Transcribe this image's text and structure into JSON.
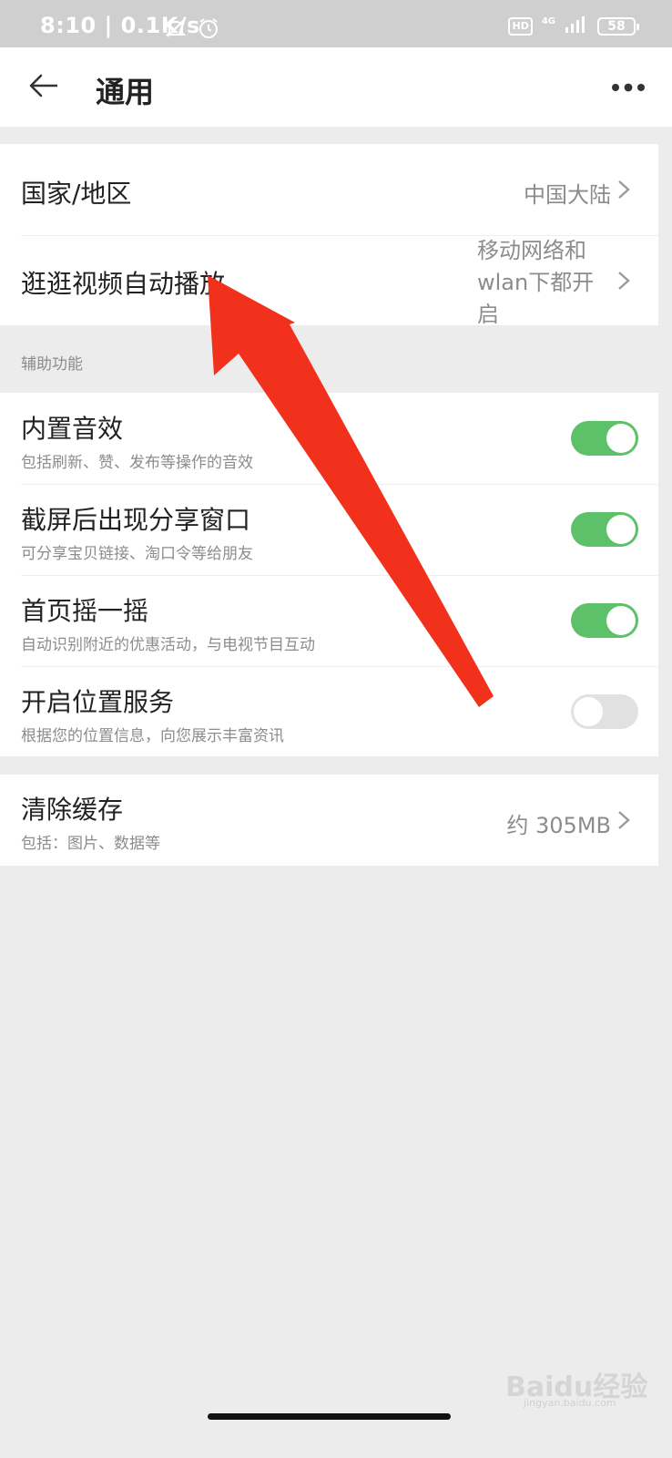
{
  "status_bar": {
    "time": "8:10 | 0.1K/s",
    "hd_label": "HD",
    "network_label": "4G",
    "battery": "58",
    "icons": [
      "bell-muted-icon",
      "alarm-icon",
      "signal-icon"
    ]
  },
  "header": {
    "title": "通用",
    "back_icon": "back-arrow-icon",
    "more_icon": "more-dots-icon"
  },
  "region_section": {
    "country": {
      "label": "国家/地区",
      "value": "中国大陆"
    },
    "video_autoplay": {
      "label": "逛逛视频自动播放",
      "value_lines": [
        "移动网络和",
        "wlan下都开",
        "启"
      ]
    }
  },
  "accessibility": {
    "group_label": "辅助功能",
    "items": [
      {
        "title": "内置音效",
        "subtitle": "包括刷新、赞、发布等操作的音效",
        "enabled": true
      },
      {
        "title": "截屏后出现分享窗口",
        "subtitle": "可分享宝贝链接、淘口令等给朋友",
        "enabled": true
      },
      {
        "title": "首页摇一摇",
        "subtitle": "自动识别附近的优惠活动，与电视节目互动",
        "enabled": true
      },
      {
        "title": "开启位置服务",
        "subtitle": "根据您的位置信息，向您展示丰富资讯",
        "enabled": false
      }
    ]
  },
  "cache": {
    "title": "清除缓存",
    "subtitle": "包括：图片、数据等",
    "value": "约 305MB"
  },
  "watermark": {
    "text": "Baidu经验",
    "sub": "jingyan.baidu.com"
  },
  "colors": {
    "toggle_on": "#5cc168",
    "toggle_off": "#e1e1e1",
    "annotation_arrow": "#f2311c"
  }
}
